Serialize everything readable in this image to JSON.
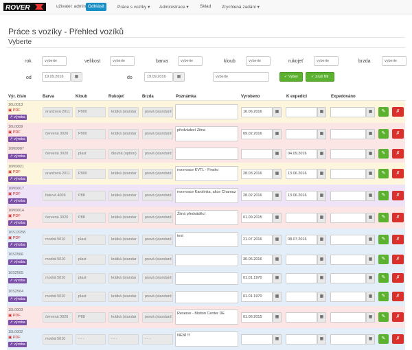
{
  "nav": {
    "user_label": "uživatel: admin",
    "logout": "Odhlásit",
    "items": [
      "Práce s vozíky ▾",
      "Administrace ▾",
      "Sklad",
      "Zrychlená zadání ▾"
    ]
  },
  "page": {
    "title": "Práce s vozíky - Přehled vozíků",
    "subtitle": "Vyberte"
  },
  "filters": {
    "rok": {
      "label": "rok",
      "value": "vyberte"
    },
    "velikost": {
      "label": "velikost",
      "value": "vyberte"
    },
    "barva": {
      "label": "barva",
      "value": "vyberte"
    },
    "kloub": {
      "label": "kloub",
      "value": "vyberte"
    },
    "rukojet": {
      "label": "rukojeť",
      "value": "vyberte"
    },
    "brzda": {
      "label": "brzda",
      "value": "vyberte"
    },
    "od": {
      "label": "od",
      "value": "19.09.2016"
    },
    "do": {
      "label": "do",
      "value": "19.09.2016"
    },
    "extra": {
      "value": "vyberte"
    },
    "btn_select": "Vyber",
    "btn_reset": "Zruš filtr"
  },
  "table": {
    "headers": [
      "Výr. číslo",
      "Barva",
      "Kloub",
      "Rukojeť",
      "Brzda",
      "Poznámka",
      "Vyrobeno",
      "K expedici",
      "Expedováno"
    ],
    "pdf_label": "PDF",
    "vyroba_label": "výroba",
    "cal_icon": "▦",
    "edit_icon": "✎",
    "delete_icon": "✗",
    "rows": [
      {
        "code": "16L0013",
        "barva": "oranžová 2011",
        "kloub": "P900",
        "rukojet": "krátká (standar",
        "brzda": "pravá (standard",
        "note": "",
        "vyrobeno": "16.06.2016",
        "expedice": "",
        "expedovano": "",
        "bg": "#fdf6dd"
      },
      {
        "code": "16L0009",
        "barva": "červená 3020",
        "kloub": "P900",
        "rukojet": "krátká (standar",
        "brzda": "pravá (standard",
        "note": "předvádecí Zitna",
        "vyrobeno": "09.02.2016",
        "expedice": "",
        "expedovano": "",
        "bg": "#fbe5e5"
      },
      {
        "code": "16M0987",
        "barva": "červená 3020",
        "kloub": "plast",
        "rukojet": "dlouhá (option)",
        "brzda": "pravá (standard",
        "note": "",
        "vyrobeno": "",
        "expedice": "04.09.2016",
        "expedovano": "",
        "bg": "#fbe5e5"
      },
      {
        "code": "16M0021",
        "barva": "oranžová 2011",
        "kloub": "P900",
        "rukojet": "krátká (standar",
        "brzda": "pravá (standard",
        "note": "rezervace KVTL - Finsko",
        "vyrobeno": "28.03.2016",
        "expedice": "13.06.2016",
        "expedovano": "",
        "bg": "#fdf6dd"
      },
      {
        "code": "16M0017",
        "barva": "fialová 4006",
        "kloub": "P88",
        "rukojet": "krátká (standar",
        "brzda": "pravá (standard",
        "note": "rezervace Karolinka, akce Charouz",
        "vyrobeno": "28.02.2016",
        "expedice": "13.06.2016",
        "expedovano": "",
        "bg": "#efe3f7"
      },
      {
        "code": "16M0014",
        "barva": "červená 3020",
        "kloub": "P88",
        "rukojet": "krátká (standar",
        "brzda": "pravá (standard",
        "note": "Žitná předváděcí",
        "vyrobeno": "01.09.2015",
        "expedice": "",
        "expedovano": "",
        "bg": "#fbe5e5"
      },
      {
        "code": "16S13258",
        "barva": "modrá 5010",
        "kloub": "plast",
        "rukojet": "krátká (standar",
        "brzda": "pravá (standard",
        "note": "test",
        "vyrobeno": "21.07.2016",
        "expedice": "08.07.2016",
        "expedovano": "",
        "bg": "#e3eef8"
      },
      {
        "code": "16S2566",
        "barva": "modrá 5010",
        "kloub": "plast",
        "rukojet": "krátká (standar",
        "brzda": "pravá (standard",
        "note": "",
        "vyrobeno": "30.06.2016",
        "expedice": "",
        "expedovano": "",
        "bg": "#e3eef8"
      },
      {
        "code": "16S2565",
        "barva": "modrá 5010",
        "kloub": "plast",
        "rukojet": "krátká (standar",
        "brzda": "pravá (standard",
        "note": "",
        "vyrobeno": "01.01.1970",
        "expedice": "",
        "expedovano": "",
        "bg": "#e3eef8"
      },
      {
        "code": "16S2564",
        "barva": "modrá 5010",
        "kloub": "plast",
        "rukojet": "krátká (standar",
        "brzda": "pravá (standard",
        "note": "",
        "vyrobeno": "01.01.1970",
        "expedice": "",
        "expedovano": "",
        "bg": "#e3eef8"
      },
      {
        "code": "15L0003",
        "barva": "červená 3020",
        "kloub": "P88",
        "rukojet": "krátká (standar",
        "brzda": "pravá (standard",
        "note": "Reserve - Motion Center DE",
        "vyrobeno": "01.06.2015",
        "expedice": "",
        "expedovano": "",
        "bg": "#fbe5e5"
      },
      {
        "code": "15L0002",
        "barva": "modrá 5010",
        "kloub": "- - -",
        "rukojet": "- - -",
        "brzda": "- - -",
        "note": "NENÍ !!!",
        "vyrobeno": "",
        "expedice": "",
        "expedovano": "",
        "bg": "#e3eef8"
      }
    ]
  }
}
